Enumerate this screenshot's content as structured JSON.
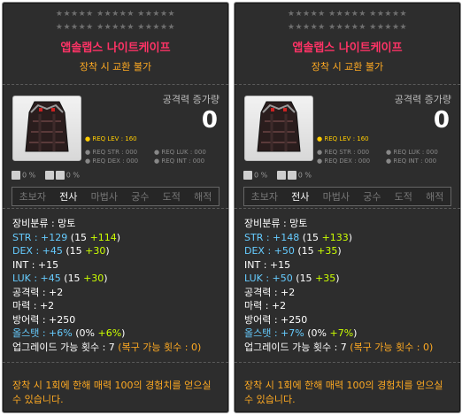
{
  "stars": "★★★★★  ★★★★★  ★★★★★",
  "colors": {
    "title": "#ff3366",
    "subtitle": "#ffaa22",
    "stat_cyan": "#66ccff",
    "stat_green": "#ccff00"
  },
  "cards": [
    {
      "title": "앱솔랩스 나이트케이프",
      "subtitle": "장착 시 교환 불가",
      "attack_label": "공격력 증가량",
      "attack_value": "0",
      "req_lev": "● REQ LEV : 160",
      "req": [
        "● REQ STR : 000",
        "● REQ LUK : 000",
        "● REQ DEX : 000",
        "● REQ INT : 000"
      ],
      "icon_pct": [
        "0 %",
        "0 %"
      ],
      "jobs": [
        "초보자",
        "전사",
        "마법사",
        "궁수",
        "도적",
        "해적"
      ],
      "category": "장비분류 : 망토",
      "str": {
        "label": "STR : +129",
        "base": "15",
        "bonus": "+114"
      },
      "dex": {
        "label": "DEX : +45",
        "base": "15",
        "bonus": "+30"
      },
      "int": "INT : +15",
      "luk": {
        "label": "LUK : +45",
        "base": "15",
        "bonus": "+30"
      },
      "atk": "공격력 : +2",
      "mag": "마력 : +2",
      "def": "방어력 : +250",
      "allstat": {
        "label": "올스탯 : +6%",
        "base": "0%",
        "bonus": "+6%"
      },
      "upgrade": "업그레이드 가능 횟수 : 7",
      "upgrade_extra": "(복구 가능 횟수 : 0)",
      "desc": "장착 시 1회에 한해 매력 100의 경험치를 얻으실 수 있습니다."
    },
    {
      "title": "앱솔랩스 나이트케이프",
      "subtitle": "장착 시 교환 불가",
      "attack_label": "공격력 증가량",
      "attack_value": "0",
      "req_lev": "● REQ LEV : 160",
      "req": [
        "● REQ STR : 000",
        "● REQ LUK : 000",
        "● REQ DEX : 000",
        "● REQ INT : 000"
      ],
      "icon_pct": [
        "0 %",
        "0 %"
      ],
      "jobs": [
        "초보자",
        "전사",
        "마법사",
        "궁수",
        "도적",
        "해적"
      ],
      "category": "장비분류 : 망토",
      "str": {
        "label": "STR : +148",
        "base": "15",
        "bonus": "+133"
      },
      "dex": {
        "label": "DEX : +50",
        "base": "15",
        "bonus": "+35"
      },
      "int": "INT : +15",
      "luk": {
        "label": "LUK : +50",
        "base": "15",
        "bonus": "+35"
      },
      "atk": "공격력 : +2",
      "mag": "마력 : +2",
      "def": "방어력 : +250",
      "allstat": {
        "label": "올스탯 : +7%",
        "base": "0%",
        "bonus": "+7%"
      },
      "upgrade": "업그레이드 가능 횟수 : 7",
      "upgrade_extra": "(복구 가능 횟수 : 0)",
      "desc": "장착 시 1회에 한해 매력 100의 경험치를 얻으실 수 있습니다."
    }
  ]
}
